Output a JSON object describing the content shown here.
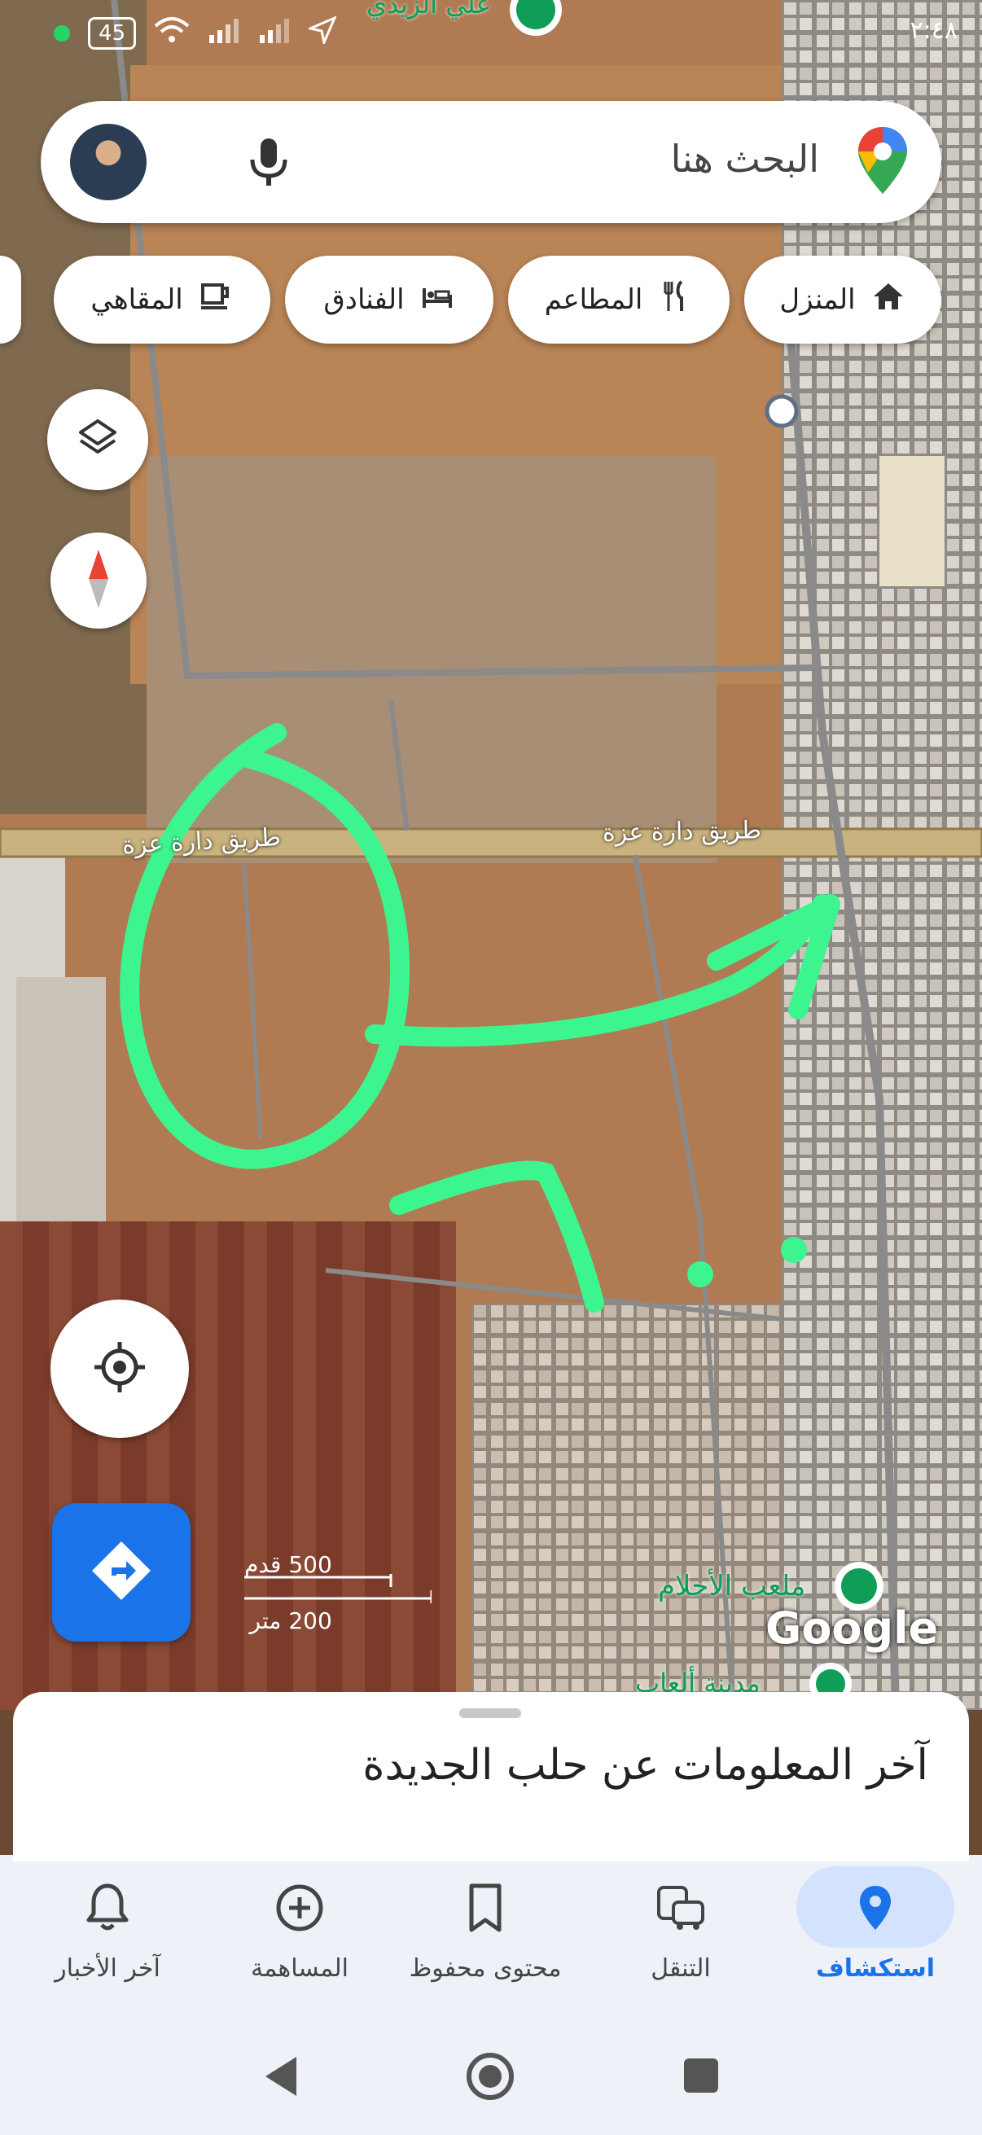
{
  "status": {
    "battery": "45",
    "time": "٢:٤٨"
  },
  "search": {
    "placeholder": "البحث هنا"
  },
  "chips": [
    {
      "label": "المنزل",
      "icon": "home-icon"
    },
    {
      "label": "المطاعم",
      "icon": "restaurant-icon"
    },
    {
      "label": "الفنادق",
      "icon": "hotel-icon"
    },
    {
      "label": "المقاهي",
      "icon": "cafe-icon"
    }
  ],
  "map": {
    "road_label": "طريق دارة عزة",
    "poi_top": "علي الزيدي",
    "poi_bottom": "ملعب الأحلام",
    "poi_bottom2": "مدينة ألعاب",
    "scale_ft": "500 قدم",
    "scale_m": "200 متر",
    "logo": "Google"
  },
  "sheet": {
    "title": "آخر المعلومات عن حلب الجديدة"
  },
  "nav": [
    {
      "label": "استكشاف",
      "icon": "explore-pin-icon",
      "active": true
    },
    {
      "label": "التنقل",
      "icon": "commute-icon"
    },
    {
      "label": "محتوى محفوظ",
      "icon": "bookmark-icon"
    },
    {
      "label": "المساهمة",
      "icon": "add-circle-icon"
    },
    {
      "label": "آخر الأخبار",
      "icon": "bell-icon"
    }
  ],
  "colors": {
    "accent": "#1a73e8",
    "annotation": "#3df58f"
  }
}
